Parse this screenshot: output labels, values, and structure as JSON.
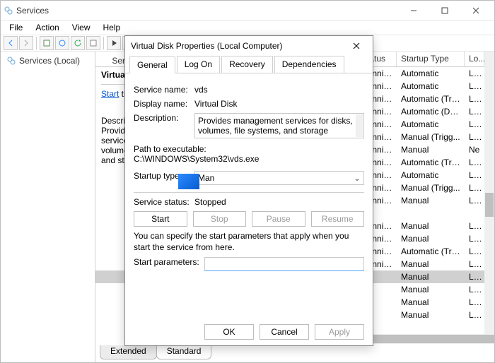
{
  "window": {
    "title": "Services"
  },
  "menu": {
    "file": "File",
    "action": "Action",
    "view": "View",
    "help": "Help"
  },
  "tree": {
    "root": "Services (Local)"
  },
  "list_header": {
    "status": "Status",
    "startup": "Startup Type",
    "log": "Lo..."
  },
  "detail": {
    "services_local": "Service",
    "name": "Virtual Disk",
    "start_link": "Start",
    "start_tail": " the service",
    "desc_label": "Description:",
    "desc_text": "Provides management services for disks, volumes, file systems, and storage arrays."
  },
  "rows": [
    {
      "status": "Running",
      "startup": "Automatic",
      "log": "Loc"
    },
    {
      "status": "Running",
      "startup": "Automatic",
      "log": "Loc"
    },
    {
      "status": "Running",
      "startup": "Automatic (Tri...",
      "log": "Loc"
    },
    {
      "status": "Running",
      "startup": "Automatic (De...",
      "log": "Loc"
    },
    {
      "status": "Running",
      "startup": "Automatic",
      "log": "Loc"
    },
    {
      "status": "Running",
      "startup": "Manual (Trigg...",
      "log": "Loc"
    },
    {
      "status": "Running",
      "startup": "Manual",
      "log": "Ne"
    },
    {
      "status": "Running",
      "startup": "Automatic (Tri...",
      "log": "Loc"
    },
    {
      "status": "Running",
      "startup": "Automatic",
      "log": "Loc"
    },
    {
      "status": "Running",
      "startup": "Manual (Trigg...",
      "log": "Loc"
    },
    {
      "status": "Running",
      "startup": "Manual",
      "log": "Loc"
    },
    {
      "status": "",
      "startup": "",
      "log": ""
    },
    {
      "status": "Running",
      "startup": "Manual",
      "log": "Loc"
    },
    {
      "status": "Running",
      "startup": "Manual",
      "log": "Loc"
    },
    {
      "status": "Running",
      "startup": "Automatic (Tri...",
      "log": "Loc"
    },
    {
      "status": "Running",
      "startup": "Manual",
      "log": "Loc"
    },
    {
      "status": "",
      "startup": "Manual",
      "log": "Loc",
      "sel": true
    },
    {
      "status": "",
      "startup": "Manual",
      "log": "Loc"
    },
    {
      "status": "",
      "startup": "Manual",
      "log": "Loc"
    },
    {
      "status": "",
      "startup": "Manual",
      "log": "Loc"
    }
  ],
  "tabs": {
    "extended": "Extended",
    "standard": "Standard"
  },
  "dialog": {
    "title": "Virtual Disk Properties (Local Computer)",
    "tabs": {
      "general": "General",
      "logon": "Log On",
      "recovery": "Recovery",
      "dependencies": "Dependencies"
    },
    "svc_name_label": "Service name:",
    "svc_name": "vds",
    "disp_name_label": "Display name:",
    "disp_name": "Virtual Disk",
    "desc_label": "Description:",
    "desc": "Provides management services for disks, volumes, file systems, and storage arrays.",
    "path_label": "Path to executable:",
    "path": "C:\\WINDOWS\\System32\\vds.exe",
    "startup_label": "Startup type:",
    "startup_value": "Man",
    "status_label": "Service status:",
    "status_value": "Stopped",
    "btn_start": "Start",
    "btn_stop": "Stop",
    "btn_pause": "Pause",
    "btn_resume": "Resume",
    "params_help": "You can specify the start parameters that apply when you start the service from here.",
    "params_label": "Start parameters:",
    "ok": "OK",
    "cancel": "Cancel",
    "apply": "Apply"
  }
}
